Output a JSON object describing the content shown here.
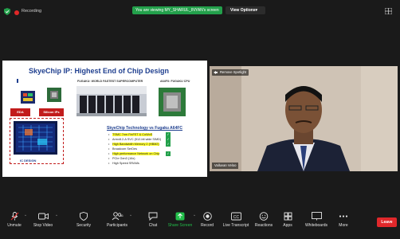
{
  "topbar": {
    "recording_label": "Recording",
    "share_banner": "You are viewing MY_SHARUL_INYAN's screen",
    "view_options_label": "View Options"
  },
  "slide": {
    "title": "SkyeChip IP:  Highest End of Chip Design",
    "fugaku_label": "FUGAKU: WORLD FASTEST SUPERCOMPUTER",
    "a64fx_label": "A64FX: FUGAKU CPU",
    "eda_label": "EDA",
    "silicon_ips_label": "Silicon IPs",
    "ic_design_label": "IC DESIGN",
    "tech_title": "SkyeChip Technology vs Fugaku A64FC",
    "tech_items": [
      {
        "text": "TSMC 7nm FinFET & CoWoS",
        "highlight": true,
        "check": true
      },
      {
        "text": "Armv8.2-A SVC (512-bit wide SIMD)",
        "highlight": false,
        "check": true
      },
      {
        "text": "High Bandwidth Memory 2 (HBM2)",
        "highlight": true,
        "check": true
      },
      {
        "text": "Broadcom SerDes",
        "highlight": false,
        "check": false
      },
      {
        "text": "High performance Network on Chip",
        "highlight": true,
        "check": true
      },
      {
        "text": "PCIe Gen3 (16x)",
        "highlight": false,
        "check": false
      },
      {
        "text": "High Speed SRAMs",
        "highlight": false,
        "check": false
      }
    ]
  },
  "video": {
    "spotlight_label": "Remove Spotlight",
    "participant_name": "Valluvan Veloo"
  },
  "toolbar": {
    "items": [
      {
        "label": "Unmute"
      },
      {
        "label": "Stop Video"
      },
      {
        "label": "Security"
      },
      {
        "label": "Participants",
        "count": "36"
      },
      {
        "label": "Chat"
      },
      {
        "label": "Share Screen"
      },
      {
        "label": "Record"
      },
      {
        "label": "Live Transcript"
      },
      {
        "label": "Reactions"
      },
      {
        "label": "Apps"
      },
      {
        "label": "Whiteboards"
      },
      {
        "label": "More"
      }
    ],
    "leave_label": "Leave"
  },
  "colors": {
    "share_green": "#23a04b",
    "record_red": "#e02828",
    "leave_red": "#e0282b",
    "slide_title_blue": "#1f3f8f"
  }
}
